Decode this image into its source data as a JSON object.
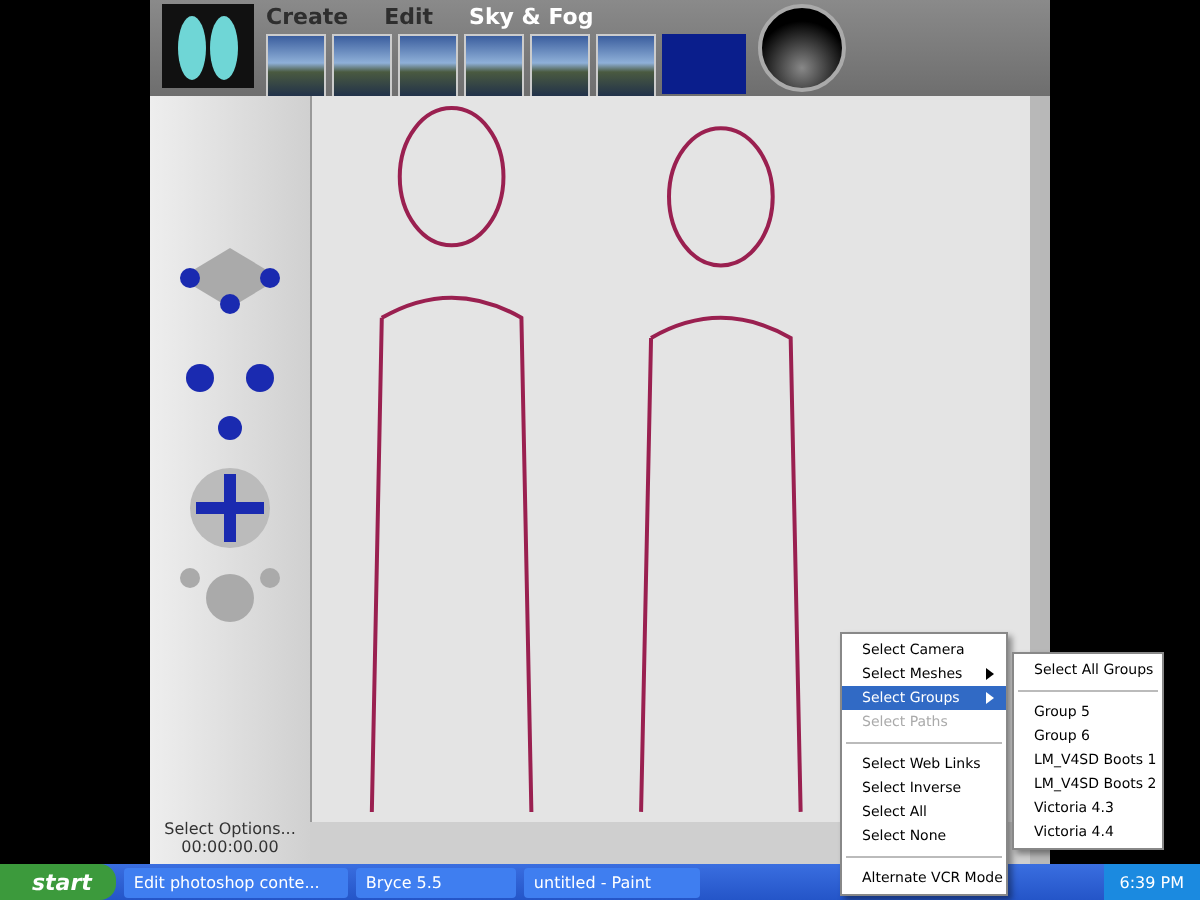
{
  "nav": [
    {
      "label": "Create",
      "selected": false
    },
    {
      "label": "Edit",
      "selected": false
    },
    {
      "label": "Sky & Fog",
      "selected": true
    }
  ],
  "status": {
    "label": "Select Options...",
    "time": "00:00:00.00"
  },
  "context_menu": [
    {
      "kind": "item",
      "label": "Select Camera",
      "submenu": false,
      "disabled": false,
      "selected": false
    },
    {
      "kind": "item",
      "label": "Select Meshes",
      "submenu": true,
      "disabled": false,
      "selected": false
    },
    {
      "kind": "item",
      "label": "Select Groups",
      "submenu": true,
      "disabled": false,
      "selected": true
    },
    {
      "kind": "item",
      "label": "Select Paths",
      "submenu": false,
      "disabled": true,
      "selected": false
    },
    {
      "kind": "separator"
    },
    {
      "kind": "item",
      "label": "Select Web Links",
      "submenu": false,
      "disabled": false,
      "selected": false
    },
    {
      "kind": "item",
      "label": "Select Inverse",
      "submenu": false,
      "disabled": false,
      "selected": false
    },
    {
      "kind": "item",
      "label": "Select All",
      "submenu": false,
      "disabled": false,
      "selected": false
    },
    {
      "kind": "item",
      "label": "Select None",
      "submenu": false,
      "disabled": false,
      "selected": false
    },
    {
      "kind": "separator"
    },
    {
      "kind": "item",
      "label": "Alternate VCR Mode",
      "submenu": false,
      "disabled": false,
      "selected": false
    }
  ],
  "submenu": [
    {
      "kind": "item",
      "label": "Select All Groups"
    },
    {
      "kind": "separator"
    },
    {
      "kind": "item",
      "label": "Group 5"
    },
    {
      "kind": "item",
      "label": "Group 6"
    },
    {
      "kind": "item",
      "label": "LM_V4SD Boots 1"
    },
    {
      "kind": "item",
      "label": "LM_V4SD Boots 2"
    },
    {
      "kind": "item",
      "label": "Victoria 4.3"
    },
    {
      "kind": "item",
      "label": "Victoria 4.4"
    }
  ],
  "taskbar": {
    "start": "start",
    "tasks": [
      "Edit photoshop conte...",
      "Bryce 5.5",
      "untitled - Paint"
    ],
    "clock": "6:39 PM"
  }
}
